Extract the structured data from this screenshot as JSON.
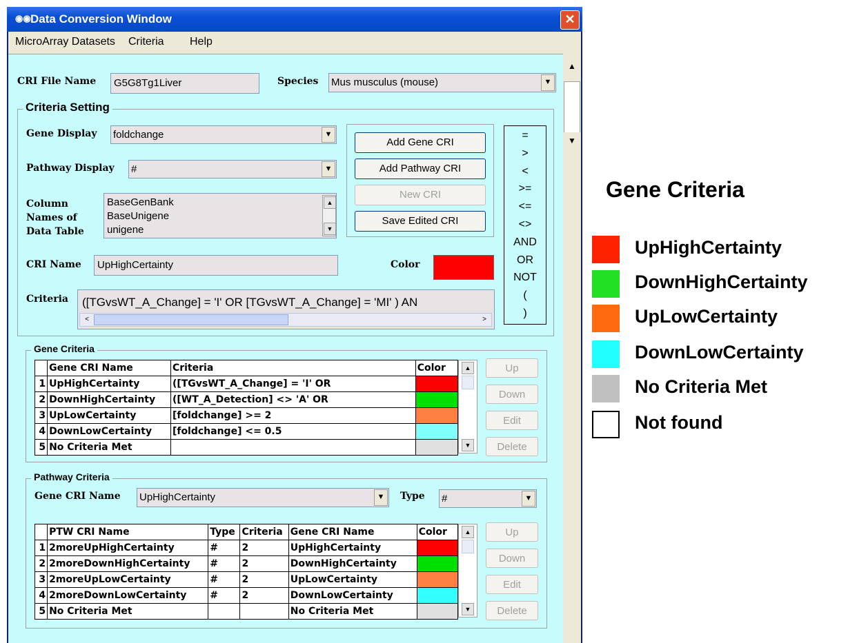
{
  "window": {
    "title": "Data Conversion Window",
    "close_glyph": "✕"
  },
  "menu": [
    "MicroArray Datasets",
    "Criteria",
    "Help"
  ],
  "cri_file": {
    "label": "CRI File Name",
    "value": "G5G8Tg1Liver"
  },
  "species": {
    "label": "Species",
    "value": "Mus musculus (mouse)"
  },
  "criteria_setting": {
    "title": "Criteria Setting",
    "gene_display": {
      "label": "Gene Display",
      "value": "foldchange"
    },
    "pathway_display": {
      "label": "Pathway Display",
      "value": "#"
    },
    "columns_label": [
      "Column",
      "Names of",
      "Data Table"
    ],
    "columns": [
      "BaseGenBank",
      "BaseUnigene",
      "unigene"
    ],
    "buttons": {
      "add_gene": "Add Gene CRI",
      "add_pathway": "Add Pathway CRI",
      "new_cri": "New CRI",
      "save_edited": "Save Edited CRI"
    },
    "operators": [
      "=",
      ">",
      "<",
      ">=",
      "<=",
      "<>",
      "AND",
      "OR",
      "NOT",
      "(",
      ")"
    ],
    "cri_name": {
      "label": "CRI Name",
      "value": "UpHighCertainty"
    },
    "color": {
      "label": "Color",
      "value": "#ff0000"
    },
    "criteria": {
      "label": "Criteria",
      "value": "([TGvsWT_A_Change] = 'I' OR [TGvsWT_A_Change] = 'MI' ) AN"
    }
  },
  "gene_criteria": {
    "title": "Gene Criteria",
    "headers": [
      "Gene CRI Name",
      "Criteria",
      "Color"
    ],
    "rows": [
      {
        "n": "1",
        "name": "UpHighCertainty",
        "criteria": "([TGvsWT_A_Change] = 'I' OR",
        "color": "#ff0000"
      },
      {
        "n": "2",
        "name": "DownHighCertainty",
        "criteria": "([WT_A_Detection] <> 'A' OR",
        "color": "#00e000"
      },
      {
        "n": "3",
        "name": "UpLowCertainty",
        "criteria": "[foldchange] >= 2",
        "color": "#ff8040"
      },
      {
        "n": "4",
        "name": "DownLowCertainty",
        "criteria": "[foldchange] <= 0.5",
        "color": "#80ffff"
      },
      {
        "n": "5",
        "name": "No Criteria Met",
        "criteria": "",
        "color": "#e0e0e0"
      }
    ],
    "buttons": {
      "up": "Up",
      "down": "Down",
      "edit": "Edit",
      "delete": "Delete"
    }
  },
  "pathway_criteria": {
    "title": "Pathway Criteria",
    "gene_cri_label": "Gene CRI Name",
    "gene_cri_value": "UpHighCertainty",
    "type_label": "Type",
    "type_value": "#",
    "headers": [
      "PTW CRI Name",
      "Type",
      "Criteria",
      "Gene CRI Name",
      "Color"
    ],
    "rows": [
      {
        "n": "1",
        "name": "2moreUpHighCertainty",
        "type": "#",
        "criteria": "2",
        "gene": "UpHighCertainty",
        "color": "#ff0000"
      },
      {
        "n": "2",
        "name": "2moreDownHighCertainty",
        "type": "#",
        "criteria": "2",
        "gene": "DownHighCertainty",
        "color": "#00e000"
      },
      {
        "n": "3",
        "name": "2moreUpLowCertainty",
        "type": "#",
        "criteria": "2",
        "gene": "UpLowCertainty",
        "color": "#ff8040"
      },
      {
        "n": "4",
        "name": "2moreDownLowCertainty",
        "type": "#",
        "criteria": "2",
        "gene": "DownLowCertainty",
        "color": "#33ffff"
      },
      {
        "n": "5",
        "name": "No Criteria Met",
        "type": "",
        "criteria": "",
        "gene": "No Criteria Met",
        "color": "#e0e0e0"
      }
    ],
    "buttons": {
      "up": "Up",
      "down": "Down",
      "edit": "Edit",
      "delete": "Delete"
    }
  },
  "legend": {
    "title": "Gene Criteria",
    "items": [
      {
        "label": "UpHighCertainty",
        "color": "#ff2200"
      },
      {
        "label": "DownHighCertainty",
        "color": "#22e022"
      },
      {
        "label": "UpLowCertainty",
        "color": "#ff6a10"
      },
      {
        "label": "DownLowCertainty",
        "color": "#22ffff"
      },
      {
        "label": "No Criteria Met",
        "color": "#c0c0c0"
      },
      {
        "label": "Not found",
        "color": "#ffffff"
      }
    ]
  }
}
